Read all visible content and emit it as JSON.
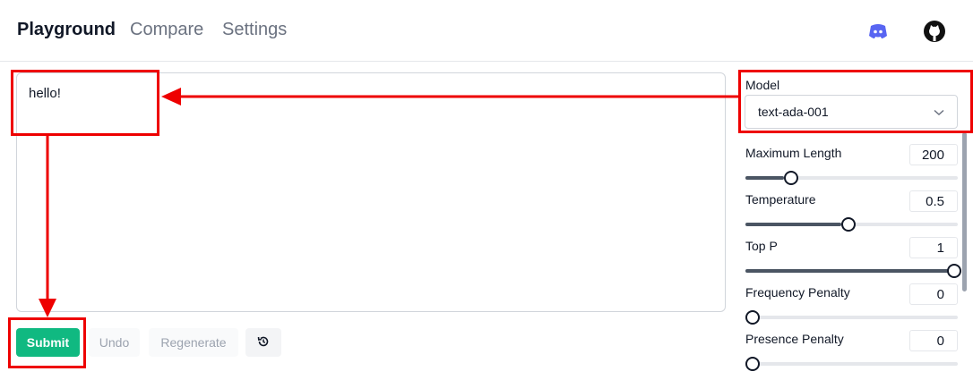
{
  "nav": {
    "tabs": [
      {
        "label": "Playground"
      },
      {
        "label": "Compare"
      },
      {
        "label": "Settings"
      }
    ],
    "icons": [
      "discord-icon",
      "github-icon"
    ]
  },
  "editor": {
    "text": "hello!"
  },
  "actions": {
    "submit": "Submit",
    "undo": "Undo",
    "regenerate": "Regenerate",
    "history_icon": "history-icon"
  },
  "sidebar": {
    "model": {
      "label": "Model",
      "value": "text-ada-001"
    },
    "params": [
      {
        "label": "Maximum Length",
        "value": "200",
        "level": 0.18
      },
      {
        "label": "Temperature",
        "value": "0.5",
        "level": 0.45
      },
      {
        "label": "Top P",
        "value": "1",
        "level": 1.0
      },
      {
        "label": "Frequency Penalty",
        "value": "0",
        "level": 0.0
      },
      {
        "label": "Presence Penalty",
        "value": "0",
        "level": 0.0
      }
    ]
  },
  "colors": {
    "accent": "#10b981",
    "annotation": "#ee0000",
    "discord": "#5865f2"
  }
}
